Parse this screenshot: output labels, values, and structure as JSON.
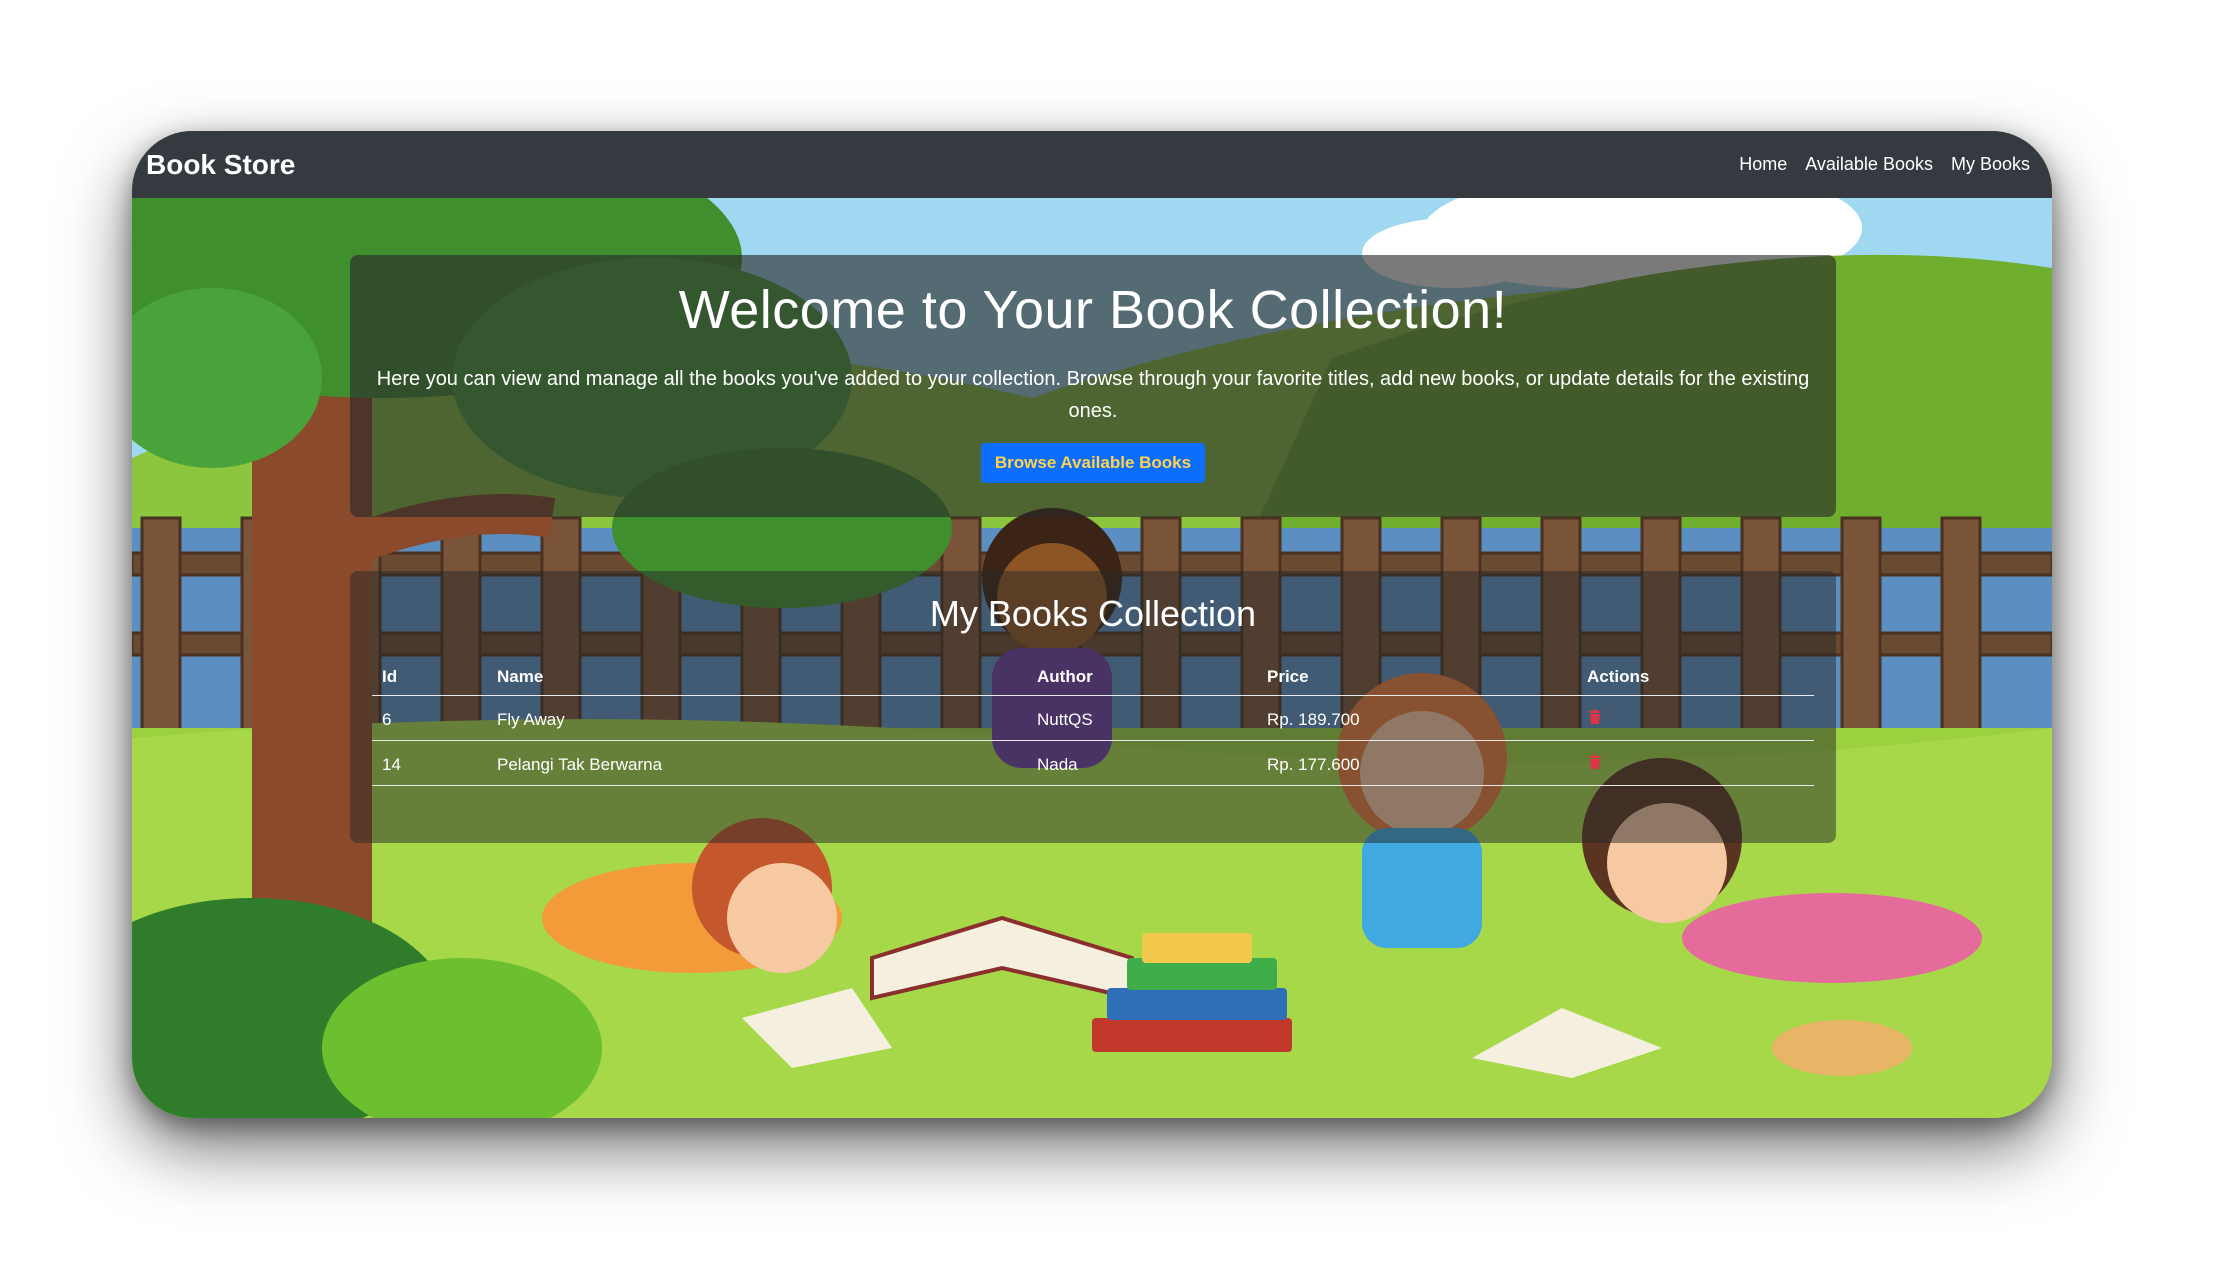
{
  "navbar": {
    "brand": "Book Store",
    "links": [
      "Home",
      "Available Books",
      "My Books"
    ]
  },
  "hero": {
    "title": "Welcome to Your Book Collection!",
    "description": "Here you can view and manage all the books you've added to your collection. Browse through your favorite titles, add new books, or update details for the existing ones.",
    "button_label": "Browse Available Books"
  },
  "collection": {
    "title": "My Books Collection",
    "columns": [
      "Id",
      "Name",
      "Author",
      "Price",
      "Actions"
    ],
    "rows": [
      {
        "id": "6",
        "name": "Fly Away",
        "author": "NuttQS",
        "price": "Rp. 189.700",
        "action_icon": "trash-icon"
      },
      {
        "id": "14",
        "name": "Pelangi Tak Berwarna",
        "author": "Nada",
        "price": "Rp. 177.600",
        "action_icon": "trash-icon"
      }
    ]
  },
  "colors": {
    "navbar_bg": "#343a40",
    "button_bg": "#0d6efd",
    "button_text": "#ffd24d",
    "delete_icon": "#dc3545"
  }
}
